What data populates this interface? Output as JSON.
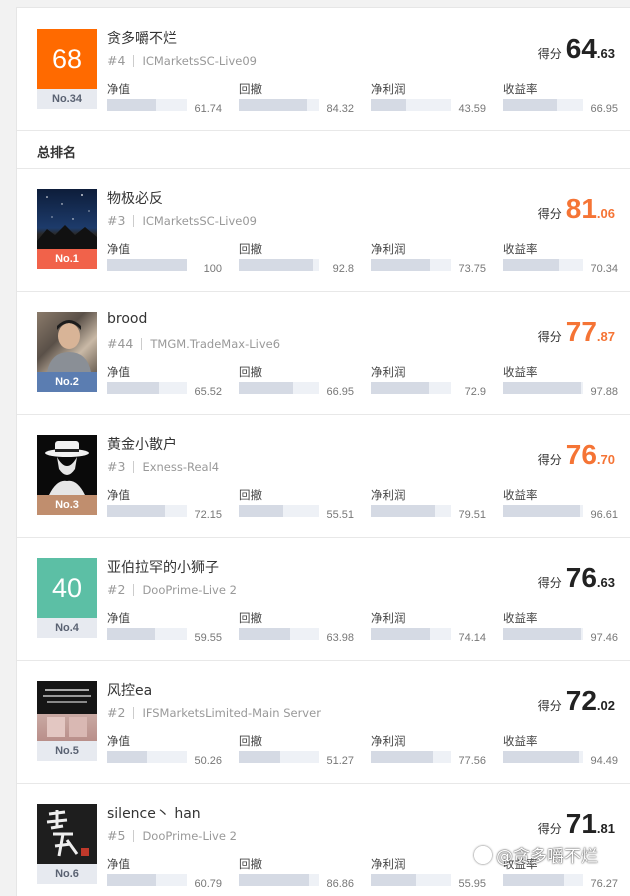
{
  "colors": {
    "accent": "#f57435",
    "number_teal": "#5cbfa5",
    "number_orange": "#ff6a00",
    "rank_gold": "#c08e6e",
    "rank_blue": "#5b7db1",
    "rank_red": "#f1624a",
    "rank_gray": "#e7eaf0"
  },
  "labels": {
    "score": "得分",
    "m1": "净值",
    "m2": "回撤",
    "m3": "净利润",
    "m4": "收益率"
  },
  "section_title": "总排名",
  "watermark": "@贪多嚼不烂",
  "top_entry": {
    "avatar_number": "68",
    "rank": "No.34",
    "name": "贪多嚼不烂",
    "hash": "#4",
    "server": "ICMarketsSC-Live09",
    "score_int": "64",
    "score_dec": ".63",
    "metrics": [
      "61.74",
      "84.32",
      "43.59",
      "66.95"
    ]
  },
  "entries": [
    {
      "avatar": "starry-sky-image",
      "rank": "No.1",
      "name": "物极必反",
      "hash": "#3",
      "server": "ICMarketsSC-Live09",
      "score_int": "81",
      "score_dec": ".06",
      "metrics": [
        "100",
        "92.8",
        "73.75",
        "70.34"
      ]
    },
    {
      "avatar": "person-photo",
      "rank": "No.2",
      "name": "brood",
      "hash": "#44",
      "server": "TMGM.TradeMax-Live6",
      "score_int": "77",
      "score_dec": ".87",
      "metrics": [
        "65.52",
        "66.95",
        "72.9",
        "97.88"
      ]
    },
    {
      "avatar": "gentleman-silhouette-image",
      "rank": "No.3",
      "name": "黄金小散户",
      "hash": "#3",
      "server": "Exness-Real4",
      "score_int": "76",
      "score_dec": ".70",
      "metrics": [
        "72.15",
        "55.51",
        "79.51",
        "96.61"
      ]
    },
    {
      "avatar_number": "40",
      "rank": "No.4",
      "name": "亚伯拉罕的小狮子",
      "hash": "#2",
      "server": "DooPrime-Live 2",
      "score_int": "76",
      "score_dec": ".63",
      "metrics": [
        "59.55",
        "63.98",
        "74.14",
        "97.46"
      ]
    },
    {
      "avatar": "dark-text-card-image",
      "rank": "No.5",
      "name": "风控ea",
      "hash": "#2",
      "server": "IFSMarketsLimited-Main Server",
      "score_int": "72",
      "score_dec": ".02",
      "metrics": [
        "50.26",
        "51.27",
        "77.56",
        "94.49"
      ]
    },
    {
      "avatar": "calligraphy-image",
      "rank": "No.6",
      "name": "silence丶 han",
      "hash": "#5",
      "server": "DooPrime-Live 2",
      "score_int": "71",
      "score_dec": ".81",
      "metrics": [
        "60.79",
        "86.86",
        "55.95",
        "76.27"
      ]
    }
  ]
}
